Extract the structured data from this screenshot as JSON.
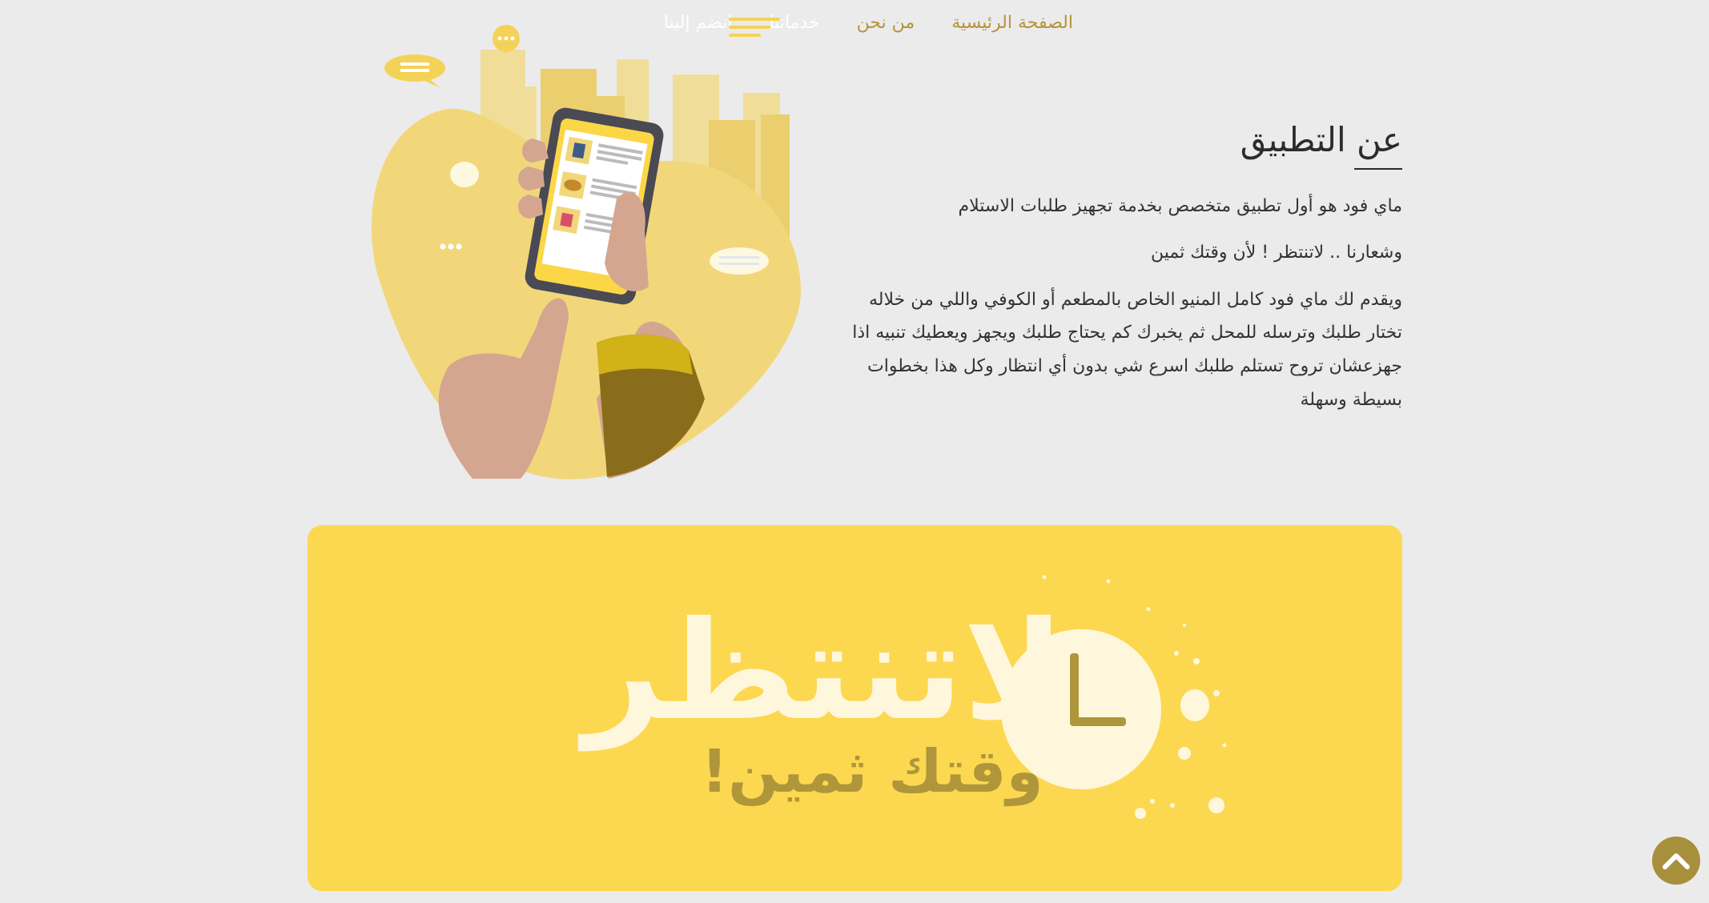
{
  "nav": {
    "items": [
      {
        "label": "الصفحة الرئيسية"
      },
      {
        "label": "من نحن"
      },
      {
        "label": "خدماتنا"
      },
      {
        "label": "انضم إلينا"
      }
    ]
  },
  "about": {
    "title": "عن التطبيق",
    "line1": "ماي فود هو أول تطبيق متخصص بخدمة تجهيز طلبات الاستلام",
    "line2": "وشعارنا .. لاتنتظر ! لأن وقتك ثمين",
    "description": "ويقدم لك ماي فود كامل المنيو الخاص بالمطعم أو الكوفي واللي من خلاله تختار طلبك وترسله للمحل ثم يخبرك كم يحتاج طلبك ويجهز ويعطيك تنبيه اذا جهزعشان تروح تستلم طلبك اسرع شي بدون أي انتظار وكل هذا بخطوات بسيطة وسهلة"
  },
  "banner": {
    "title": "لاتنتظر",
    "subtitle": "وقتك ثمين!"
  },
  "icons": {
    "scroll_top": "chevron-up-icon",
    "menu": "hamburger-menu-icon"
  },
  "colors": {
    "background": "#ebebeb",
    "accent_gold": "#b5943a",
    "banner_yellow": "#fcd850",
    "illustration_yellow": "#f2d77a"
  }
}
